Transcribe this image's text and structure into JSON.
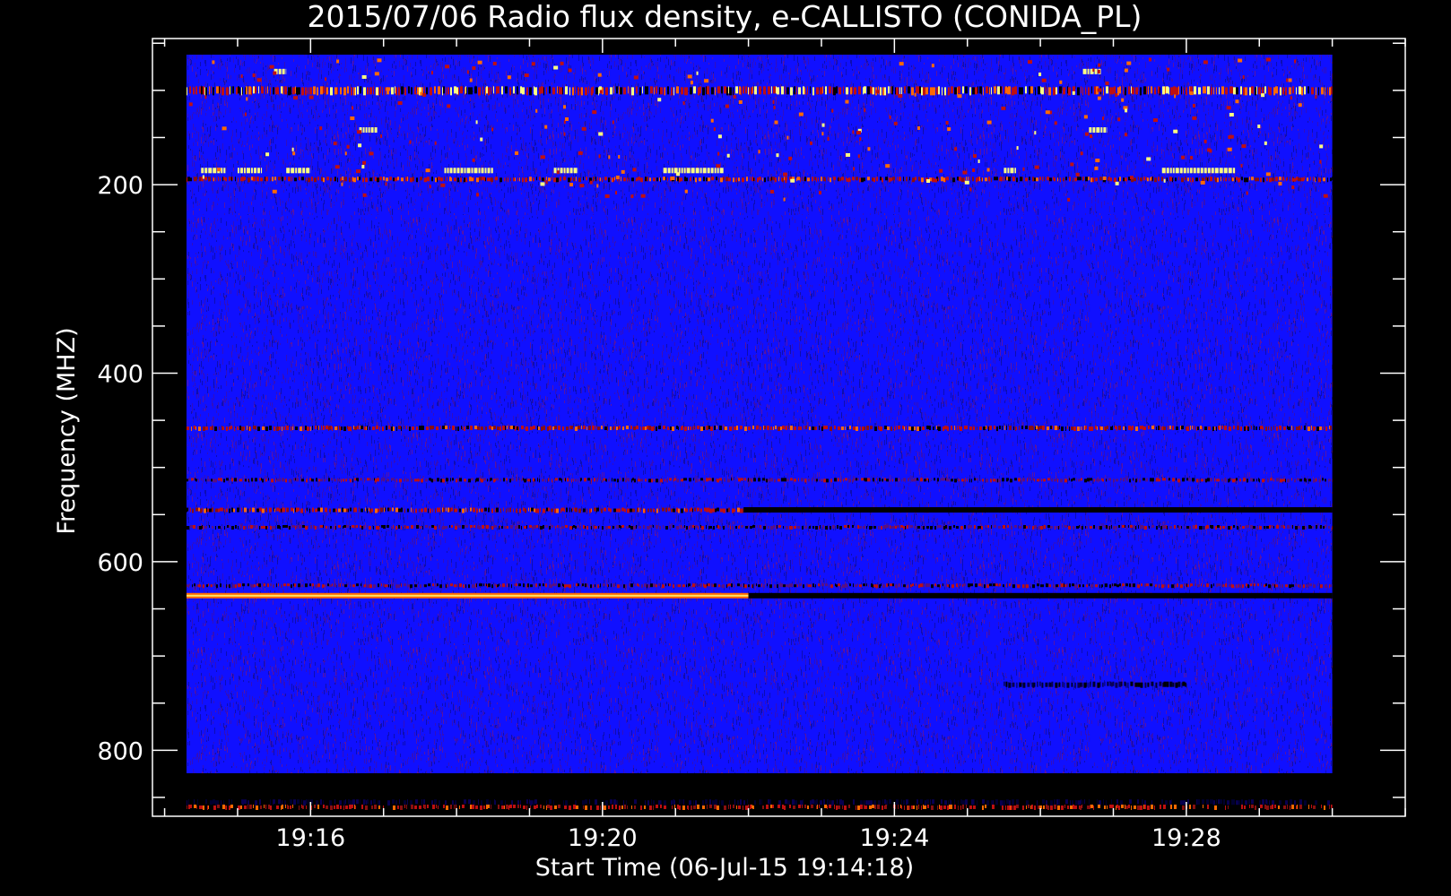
{
  "chart_data": {
    "type": "heatmap",
    "title": "2015/07/06  Radio flux density, e-CALLISTO (CONIDA_PL)",
    "xlabel": "Start Time (06-Jul-15 19:14:18)",
    "ylabel": "Frequency (MHZ)",
    "x_time_range": [
      "19:14:18",
      "19:30:00"
    ],
    "x_axis_range": [
      "19:13:50",
      "19:31:00"
    ],
    "y_axis_range_mhz": [
      45,
      870
    ],
    "y_inverted": true,
    "x_ticks": [
      "19:16",
      "19:20",
      "19:24",
      "19:28"
    ],
    "y_ticks": [
      200,
      400,
      600,
      800
    ],
    "background_level": "low",
    "colormap": [
      "#000000",
      "#1010ff",
      "#c01010",
      "#ff6a00",
      "#ffff80"
    ],
    "bands": [
      {
        "freq_mhz": 100,
        "start": "19:14:18",
        "end": "19:30:00",
        "intensity": "high",
        "pattern": "dashed"
      },
      {
        "freq_mhz": 194,
        "start": "19:14:18",
        "end": "19:30:00",
        "intensity": "medium",
        "pattern": "dashed"
      },
      {
        "freq_mhz": 458,
        "start": "19:14:18",
        "end": "19:30:00",
        "intensity": "medium",
        "pattern": "dashed"
      },
      {
        "freq_mhz": 513,
        "start": "19:14:18",
        "end": "19:30:00",
        "intensity": "low",
        "pattern": "dashed"
      },
      {
        "freq_mhz": 545,
        "start": "19:14:18",
        "end": "19:21:56",
        "intensity": "medium",
        "pattern": "dashed"
      },
      {
        "freq_mhz": 545,
        "start": "19:21:56",
        "end": "19:30:00",
        "intensity": "dark",
        "pattern": "solid"
      },
      {
        "freq_mhz": 563,
        "start": "19:14:18",
        "end": "19:30:00",
        "intensity": "low",
        "pattern": "dashed"
      },
      {
        "freq_mhz": 625,
        "start": "19:14:18",
        "end": "19:30:00",
        "intensity": "low",
        "pattern": "dashed"
      },
      {
        "freq_mhz": 636,
        "start": "19:14:18",
        "end": "19:22:00",
        "intensity": "very-high",
        "pattern": "solid"
      },
      {
        "freq_mhz": 636,
        "start": "19:22:00",
        "end": "19:30:00",
        "intensity": "dark",
        "pattern": "solid"
      },
      {
        "freq_mhz": 730,
        "start": "19:25:30",
        "end": "19:28:00",
        "intensity": "dark",
        "pattern": "dashed"
      },
      {
        "freq_mhz": 855,
        "start": "19:14:18",
        "end": "19:30:00",
        "intensity": "dark",
        "pattern": "dashed"
      },
      {
        "freq_mhz": 860,
        "start": "19:14:18",
        "end": "19:30:00",
        "intensity": "medium",
        "pattern": "dashed"
      }
    ],
    "bursts": [
      {
        "freq_mhz": 185,
        "start": "19:14:30",
        "end": "19:14:50"
      },
      {
        "freq_mhz": 185,
        "start": "19:15:00",
        "end": "19:15:20"
      },
      {
        "freq_mhz": 185,
        "start": "19:15:40",
        "end": "19:16:00"
      },
      {
        "freq_mhz": 185,
        "start": "19:17:50",
        "end": "19:18:30"
      },
      {
        "freq_mhz": 185,
        "start": "19:19:20",
        "end": "19:19:40"
      },
      {
        "freq_mhz": 185,
        "start": "19:20:50",
        "end": "19:21:40"
      },
      {
        "freq_mhz": 185,
        "start": "19:25:30",
        "end": "19:25:40"
      },
      {
        "freq_mhz": 185,
        "start": "19:27:40",
        "end": "19:28:40"
      },
      {
        "freq_mhz": 80,
        "start": "19:15:30",
        "end": "19:15:40"
      },
      {
        "freq_mhz": 80,
        "start": "19:26:35",
        "end": "19:26:50"
      },
      {
        "freq_mhz": 142,
        "start": "19:16:40",
        "end": "19:16:55"
      },
      {
        "freq_mhz": 142,
        "start": "19:26:40",
        "end": "19:26:55"
      }
    ]
  }
}
